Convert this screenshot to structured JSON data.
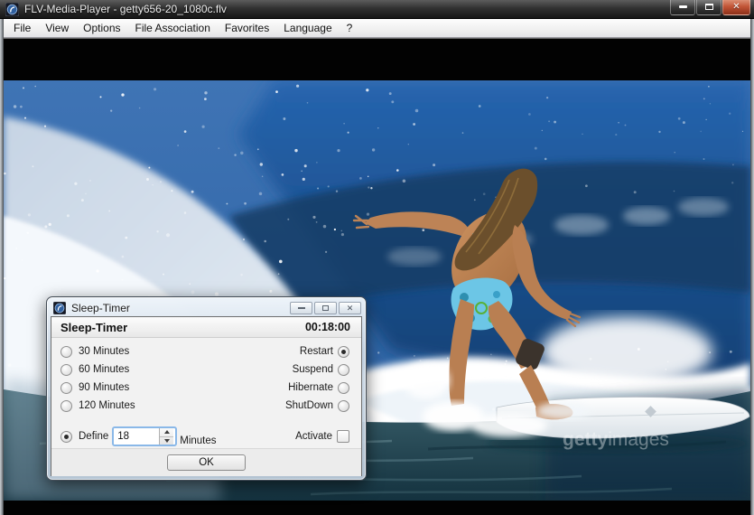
{
  "window": {
    "title": "FLV-Media-Player - getty656-20_1080c.flv",
    "close_glyph": "✕"
  },
  "menu": {
    "items": [
      "File",
      "View",
      "Options",
      "File Association",
      "Favorites",
      "Language",
      "?"
    ]
  },
  "video": {
    "watermark_bold": "getty",
    "watermark_light": "images"
  },
  "dialog": {
    "title": "Sleep-Timer",
    "close_glyph": "✕",
    "header": {
      "label": "Sleep-Timer",
      "countdown": "00:18:00"
    },
    "duration_options": [
      {
        "label": "30 Minutes",
        "selected": false
      },
      {
        "label": "60 Minutes",
        "selected": false
      },
      {
        "label": "90 Minutes",
        "selected": false
      },
      {
        "label": "120 Minutes",
        "selected": false
      }
    ],
    "action_options": [
      {
        "label": "Restart",
        "selected": true
      },
      {
        "label": "Suspend",
        "selected": false
      },
      {
        "label": "Hibernate",
        "selected": false
      },
      {
        "label": "ShutDown",
        "selected": false
      }
    ],
    "define": {
      "label": "Define",
      "selected": true,
      "value": "18",
      "unit": "Minutes"
    },
    "activate": {
      "label": "Activate",
      "checked": false
    },
    "ok_label": "OK"
  },
  "colors": {
    "close_button_red": "#c25537",
    "focus_ring_blue": "#8ab8e8",
    "ocean_blue": "#2f67ad",
    "bikini_teal": "#6cc6e6"
  }
}
